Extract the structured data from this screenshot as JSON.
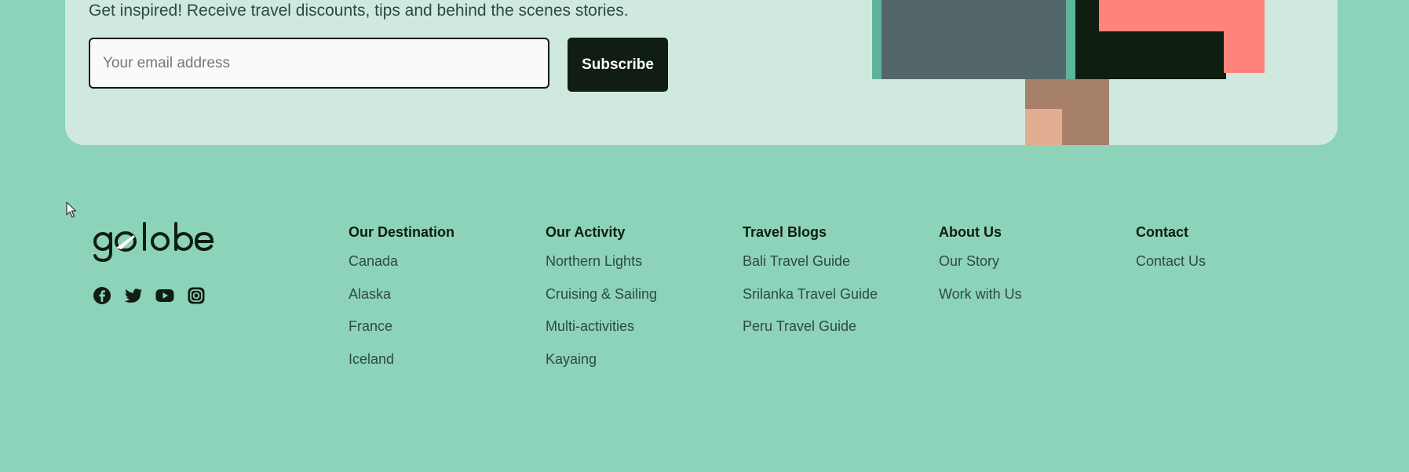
{
  "newsletter": {
    "text": "Get inspired! Receive travel discounts, tips and behind the scenes stories.",
    "email_placeholder": "Your email address",
    "subscribe_label": "Subscribe"
  },
  "brand": {
    "logo_text": "golobe"
  },
  "socials": [
    "facebook-icon",
    "twitter-icon",
    "youtube-icon",
    "instagram-icon"
  ],
  "footer": {
    "columns": [
      {
        "title": "Our Destination",
        "links": [
          "Canada",
          "Alaska",
          "France",
          "Iceland"
        ]
      },
      {
        "title": "Our Activity",
        "links": [
          "Northern Lights",
          "Cruising & Sailing",
          "Multi-activities",
          "Kayaing"
        ]
      },
      {
        "title": "Travel Blogs",
        "links": [
          "Bali Travel Guide",
          "Srilanka Travel Guide",
          "Peru Travel Guide"
        ]
      },
      {
        "title": "About Us",
        "links": [
          "Our Story",
          "Work with Us"
        ]
      },
      {
        "title": "Contact",
        "links": [
          "Contact Us"
        ]
      }
    ]
  },
  "colors": {
    "background": "#8cd3b9",
    "newsletter_card": "#cfe9df",
    "button_dark": "#0f1d12",
    "accent_coral": "#ff837a"
  }
}
